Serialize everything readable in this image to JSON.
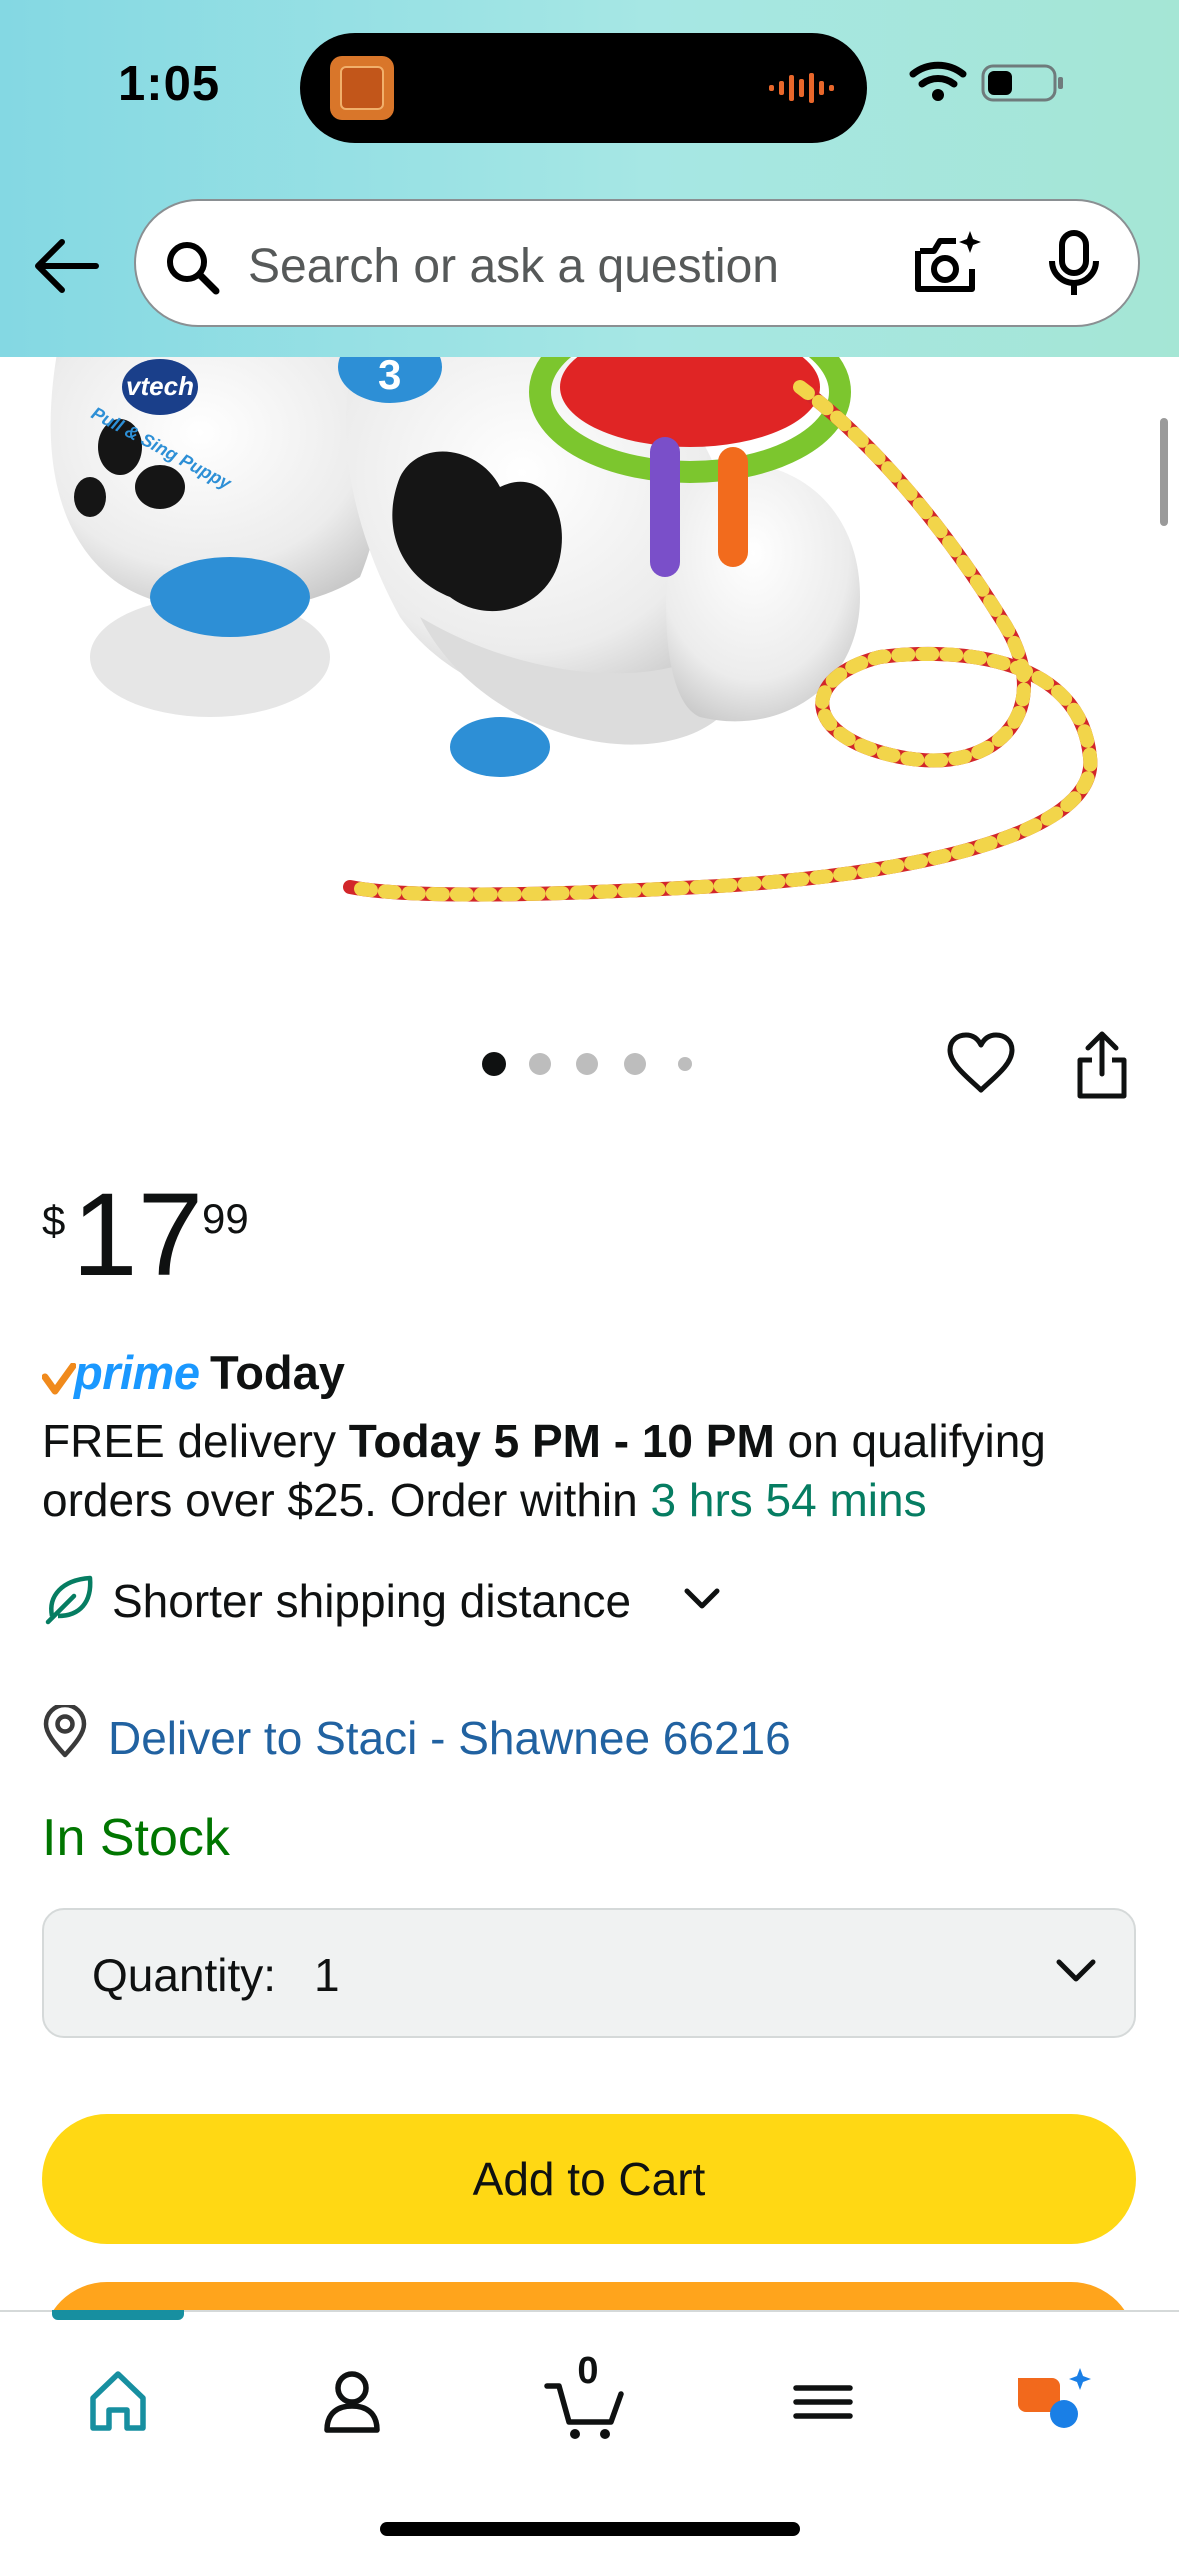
{
  "status_bar": {
    "time": "1:05"
  },
  "search": {
    "placeholder": "Search or ask a question"
  },
  "gallery": {
    "image_count": 5,
    "active_index": 0,
    "product_brand_text": "vtech",
    "product_name_text": "Pull & Sing Puppy",
    "tag_number": "3"
  },
  "price": {
    "symbol": "$",
    "whole": "17",
    "fraction": "99"
  },
  "prime": {
    "label": "prime",
    "suffix": "Today"
  },
  "delivery": {
    "prefix": "FREE delivery ",
    "window": "Today 5 PM - 10 PM",
    "middle": " on qualifying orders over $25. Order within ",
    "countdown": "3 hrs 54 mins"
  },
  "shipping": {
    "label": "Shorter shipping distance"
  },
  "deliver_to": {
    "label": "Deliver to Staci - Shawnee 66216"
  },
  "stock": {
    "label": "In Stock"
  },
  "quantity": {
    "label": "Quantity:",
    "value": "1"
  },
  "buttons": {
    "add_to_cart": "Add to Cart"
  },
  "bottom_nav": {
    "items": [
      {
        "name": "Home",
        "icon": "home-icon",
        "active": true
      },
      {
        "name": "Account",
        "icon": "person-icon",
        "active": false
      },
      {
        "name": "Cart",
        "icon": "cart-icon",
        "active": false
      },
      {
        "name": "Menu",
        "icon": "menu-icon",
        "active": false
      },
      {
        "name": "Rufus",
        "icon": "rufus-icon",
        "active": false
      }
    ],
    "cart_count": "0"
  },
  "colors": {
    "header_gradient_start": "#84d8e3",
    "header_gradient_end": "#a5e6d5",
    "link": "#2162a1",
    "in_stock": "#007600",
    "countdown": "#067d62",
    "add_to_cart": "#ffd814",
    "buy_now": "#ffa41c",
    "prime": "#1a98ff",
    "nav_active": "#178fa0"
  }
}
